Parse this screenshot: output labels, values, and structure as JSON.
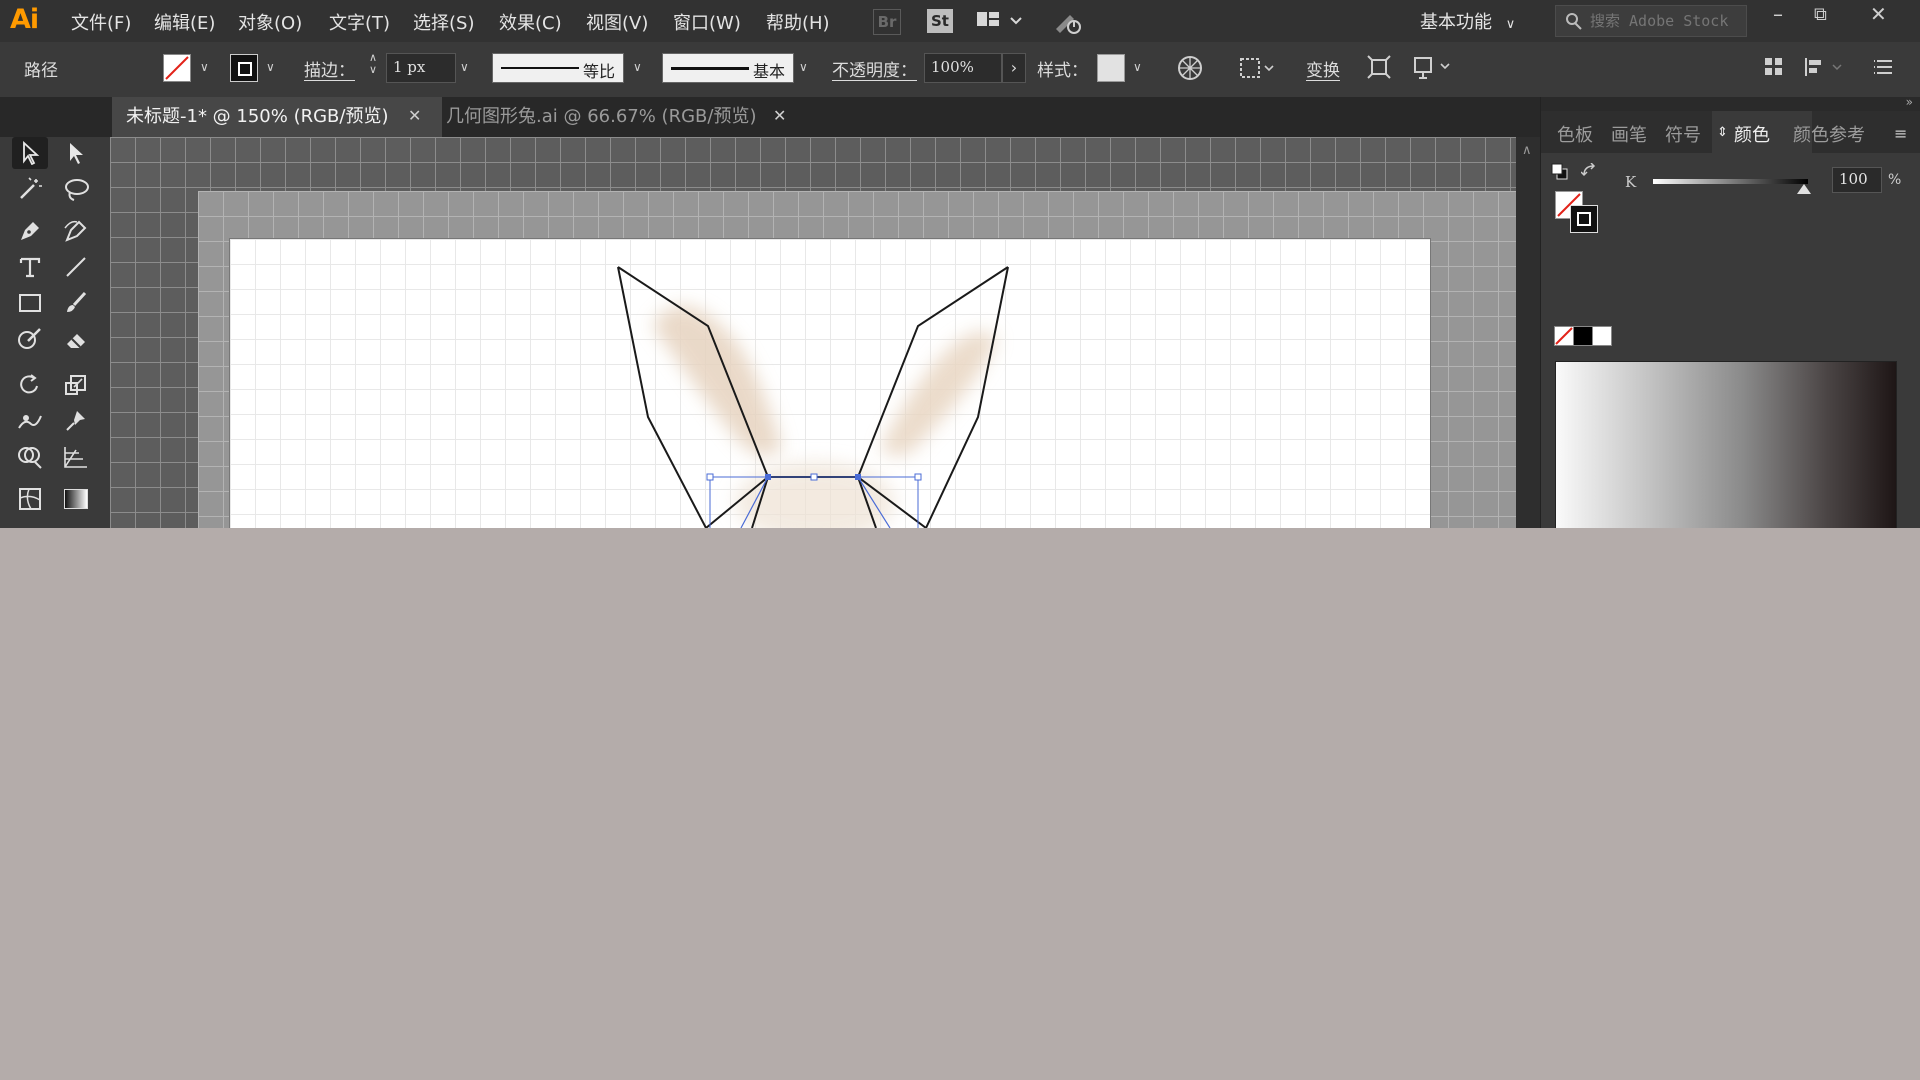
{
  "app": {
    "logo": "Ai"
  },
  "menu": [
    "文件(F)",
    "编辑(E)",
    "对象(O)",
    "文字(T)",
    "选择(S)",
    "效果(C)",
    "视图(V)",
    "窗口(W)",
    "帮助(H)"
  ],
  "menubar": {
    "bridge_label": "Br",
    "stock_label": "St",
    "workspace": "基本功能",
    "search_placeholder": "搜索 Adobe Stock"
  },
  "control": {
    "selection_type": "路径",
    "stroke_label": "描边：",
    "stroke_weight": "1 px",
    "stroke_profile": "等比",
    "brush": "基本",
    "opacity_label": "不透明度：",
    "opacity_value": "100%",
    "style_label": "样式：",
    "transform_label": "变换"
  },
  "tabs": [
    {
      "label": "未标题-1* @ 150% (RGB/预览)",
      "active": true
    },
    {
      "label": "几何图形兔.ai @ 66.67% (RGB/预览)",
      "active": false
    }
  ],
  "right_panel": {
    "tabs": [
      "色板",
      "画笔",
      "符号",
      "颜色",
      "颜色参考"
    ],
    "active_tab": "颜色",
    "k_label": "K",
    "k_value": "100",
    "k_unit": "%"
  },
  "colors": {
    "accent": "#ff9a00",
    "app_bg": "#323232",
    "desktop_bg": "#b4acaa",
    "artboard": "#ffffff",
    "selection": "#4a6bd6",
    "no_fill_slash": "#e2231a"
  }
}
